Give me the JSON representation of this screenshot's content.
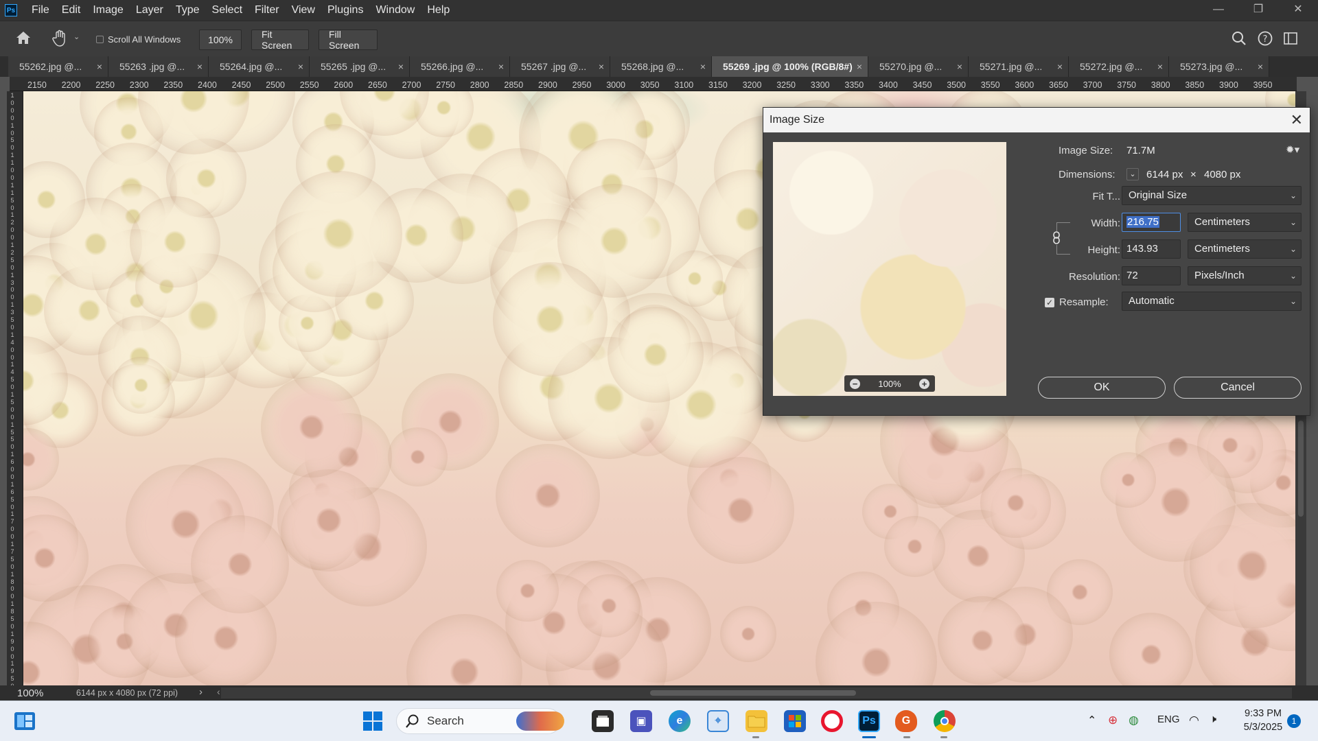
{
  "app": {
    "logo_text": "Ps"
  },
  "menu": [
    "File",
    "Edit",
    "Image",
    "Layer",
    "Type",
    "Select",
    "Filter",
    "View",
    "Plugins",
    "Window",
    "Help"
  ],
  "window_controls": {
    "minimize": "—",
    "restore": "❐",
    "close": "✕"
  },
  "options_bar": {
    "scroll_all_windows": "Scroll All Windows",
    "zoom_value": "100%",
    "fit_screen": "Fit Screen",
    "fill_screen": "Fill Screen"
  },
  "tabs": [
    {
      "label": "55262.jpg @..."
    },
    {
      "label": "55263 .jpg @..."
    },
    {
      "label": "55264.jpg @..."
    },
    {
      "label": "55265 .jpg @..."
    },
    {
      "label": "55266.jpg @..."
    },
    {
      "label": "55267 .jpg @..."
    },
    {
      "label": "55268.jpg @..."
    },
    {
      "label": "55269 .jpg @ 100% (RGB/8#)"
    },
    {
      "label": "55270.jpg @..."
    },
    {
      "label": "55271.jpg @..."
    },
    {
      "label": "55272.jpg @..."
    },
    {
      "label": "55273.jpg @..."
    }
  ],
  "tab_close": "×",
  "ruler_top": [
    "2150",
    "2200",
    "2250",
    "2300",
    "2350",
    "2400",
    "2450",
    "2500",
    "2550",
    "2600",
    "2650",
    "2700",
    "2750",
    "2800",
    "2850",
    "2900",
    "2950",
    "3000",
    "3050",
    "3100",
    "3150",
    "3200",
    "3250",
    "3300",
    "3350",
    "3400",
    "3450",
    "3500",
    "3550",
    "3600",
    "3650",
    "3700",
    "3750",
    "3800",
    "3850",
    "3900",
    "3950"
  ],
  "ruler_left": [
    "1",
    "0",
    "0",
    "0",
    "1",
    "0",
    "5",
    "0",
    "1",
    "1",
    "0",
    "0",
    "1",
    "1",
    "5",
    "0",
    "1",
    "2",
    "0",
    "0",
    "1",
    "2",
    "5",
    "0",
    "1",
    "3",
    "0",
    "0",
    "1",
    "3",
    "5",
    "0",
    "1",
    "4",
    "0",
    "0",
    "1",
    "4",
    "5",
    "0",
    "1",
    "5",
    "0",
    "0",
    "1",
    "5",
    "5",
    "0",
    "1",
    "6",
    "0",
    "0",
    "1",
    "6",
    "5",
    "0",
    "1",
    "7",
    "0",
    "0",
    "1",
    "7",
    "5",
    "0",
    "1",
    "8",
    "0",
    "0",
    "1",
    "8",
    "5",
    "0",
    "1",
    "9",
    "0",
    "0",
    "1",
    "9",
    "5",
    "0"
  ],
  "status": {
    "zoom": "100%",
    "doc_info": "6144 px x 4080 px (72 ppi)",
    "arrow": "›",
    "scroll_left": "‹"
  },
  "dialog": {
    "title": "Image Size",
    "close": "✕",
    "image_size_label": "Image Size:",
    "image_size_value": "71.7M",
    "dimensions_label": "Dimensions:",
    "dim_width": "6144 px",
    "dim_times": "×",
    "dim_height": "4080 px",
    "fit_label": "Fit T...",
    "fit_value": "Original Size",
    "width_label": "Width:",
    "width_value": "216.75",
    "width_unit": "Centimeters",
    "height_label": "Height:",
    "height_value": "143.93",
    "height_unit": "Centimeters",
    "resolution_label": "Resolution:",
    "resolution_value": "72",
    "resolution_unit": "Pixels/Inch",
    "resample_label": "Resample:",
    "resample_value": "Automatic",
    "preview_zoom": "100%",
    "ok": "OK",
    "cancel": "Cancel"
  },
  "taskbar": {
    "search": "Search",
    "language": "ENG",
    "time": "9:33 PM",
    "date": "5/3/2025",
    "notifications": "1",
    "ps_label": "Ps"
  }
}
